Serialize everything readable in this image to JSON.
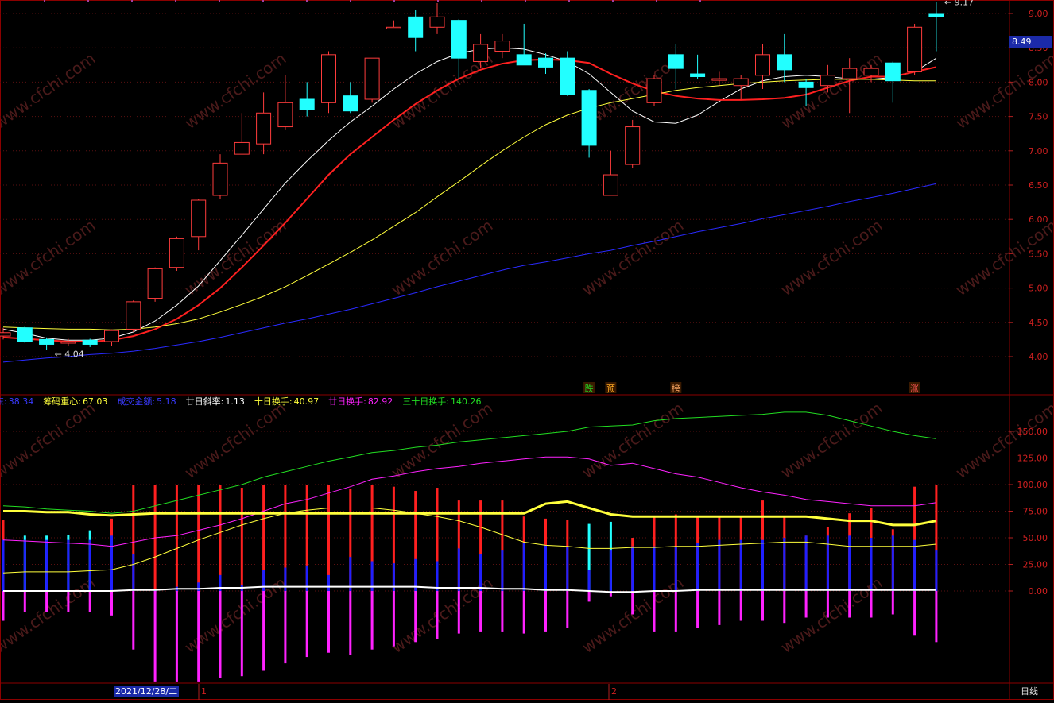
{
  "chart_data": [
    {
      "type": "candlestick",
      "title": "",
      "y_ticks": [
        "9.00",
        "8.50",
        "8.00",
        "7.50",
        "7.00",
        "6.50",
        "6.00",
        "5.50",
        "5.00",
        "4.50",
        "4.00"
      ],
      "ylim": [
        3.55,
        9.2
      ],
      "grid": true,
      "candles": [
        {
          "o": 4.3,
          "h": 4.42,
          "l": 4.25,
          "c": 4.35
        },
        {
          "o": 4.42,
          "h": 4.45,
          "l": 4.2,
          "c": 4.22
        },
        {
          "o": 4.25,
          "h": 4.28,
          "l": 4.1,
          "c": 4.18
        },
        {
          "o": 4.2,
          "h": 4.26,
          "l": 4.15,
          "c": 4.22
        },
        {
          "o": 4.24,
          "h": 4.26,
          "l": 4.14,
          "c": 4.18
        },
        {
          "o": 4.22,
          "h": 4.4,
          "l": 4.15,
          "c": 4.38
        },
        {
          "o": 4.4,
          "h": 4.82,
          "l": 4.36,
          "c": 4.8
        },
        {
          "o": 4.85,
          "h": 5.3,
          "l": 4.8,
          "c": 5.28
        },
        {
          "o": 5.3,
          "h": 5.75,
          "l": 5.25,
          "c": 5.72
        },
        {
          "o": 5.75,
          "h": 6.3,
          "l": 5.55,
          "c": 6.28
        },
        {
          "o": 6.35,
          "h": 6.95,
          "l": 6.3,
          "c": 6.82
        },
        {
          "o": 6.95,
          "h": 7.55,
          "l": 6.95,
          "c": 7.12
        },
        {
          "o": 7.1,
          "h": 7.85,
          "l": 6.95,
          "c": 7.55
        },
        {
          "o": 7.35,
          "h": 8.1,
          "l": 7.3,
          "c": 7.7
        },
        {
          "o": 7.75,
          "h": 8.0,
          "l": 7.5,
          "c": 7.6
        },
        {
          "o": 7.7,
          "h": 8.45,
          "l": 7.55,
          "c": 8.4
        },
        {
          "o": 7.8,
          "h": 8.0,
          "l": 7.55,
          "c": 7.58
        },
        {
          "o": 7.75,
          "h": 8.35,
          "l": 7.7,
          "c": 8.35
        },
        {
          "o": 8.8,
          "h": 8.9,
          "l": 8.78,
          "c": 8.8
        },
        {
          "o": 8.95,
          "h": 9.05,
          "l": 8.45,
          "c": 8.65
        },
        {
          "o": 8.8,
          "h": 9.15,
          "l": 8.7,
          "c": 8.95
        },
        {
          "o": 8.9,
          "h": 8.92,
          "l": 8.05,
          "c": 8.35
        },
        {
          "o": 8.3,
          "h": 8.7,
          "l": 8.2,
          "c": 8.55
        },
        {
          "o": 8.45,
          "h": 8.7,
          "l": 8.35,
          "c": 8.6
        },
        {
          "o": 8.4,
          "h": 8.85,
          "l": 8.35,
          "c": 8.25
        },
        {
          "o": 8.35,
          "h": 8.42,
          "l": 8.12,
          "c": 8.22
        },
        {
          "o": 8.35,
          "h": 8.45,
          "l": 7.8,
          "c": 7.82
        },
        {
          "o": 7.88,
          "h": 7.9,
          "l": 6.9,
          "c": 7.08
        },
        {
          "o": 6.35,
          "h": 7.0,
          "l": 6.35,
          "c": 6.65
        },
        {
          "o": 6.8,
          "h": 7.45,
          "l": 6.75,
          "c": 7.35
        },
        {
          "o": 7.7,
          "h": 8.1,
          "l": 7.65,
          "c": 8.05
        },
        {
          "o": 8.4,
          "h": 8.55,
          "l": 7.9,
          "c": 8.2
        },
        {
          "o": 8.12,
          "h": 8.4,
          "l": 8.05,
          "c": 8.08
        },
        {
          "o": 8.05,
          "h": 8.15,
          "l": 7.95,
          "c": 8.05
        },
        {
          "o": 7.95,
          "h": 8.1,
          "l": 7.75,
          "c": 8.05
        },
        {
          "o": 8.1,
          "h": 8.55,
          "l": 7.9,
          "c": 8.4
        },
        {
          "o": 8.4,
          "h": 8.7,
          "l": 8.0,
          "c": 8.18
        },
        {
          "o": 8.0,
          "h": 8.05,
          "l": 7.65,
          "c": 7.92
        },
        {
          "o": 7.95,
          "h": 8.25,
          "l": 7.85,
          "c": 8.1
        },
        {
          "o": 8.05,
          "h": 8.35,
          "l": 7.55,
          "c": 8.2
        },
        {
          "o": 8.1,
          "h": 8.25,
          "l": 8.0,
          "c": 8.2
        },
        {
          "o": 8.28,
          "h": 8.3,
          "l": 7.7,
          "c": 8.02
        },
        {
          "o": 8.15,
          "h": 8.85,
          "l": 8.1,
          "c": 8.8
        },
        {
          "o": 9.0,
          "h": 9.17,
          "l": 8.45,
          "c": 8.95
        }
      ],
      "series": [
        {
          "name": "",
          "color": "#ffffff",
          "values": [
            4.4,
            4.34,
            4.27,
            4.24,
            4.24,
            4.27,
            4.36,
            4.52,
            4.75,
            5.03,
            5.4,
            5.77,
            6.15,
            6.53,
            6.85,
            7.15,
            7.42,
            7.65,
            7.9,
            8.12,
            8.3,
            8.42,
            8.48,
            8.5,
            8.48,
            8.4,
            8.3,
            8.12,
            7.85,
            7.58,
            7.42,
            7.4,
            7.52,
            7.72,
            7.9,
            8.02,
            8.08,
            8.1,
            8.08,
            8.05,
            8.04,
            8.07,
            8.15,
            8.35
          ]
        },
        {
          "name": "",
          "color": "#ff2020",
          "values": [
            4.28,
            4.26,
            4.24,
            4.22,
            4.22,
            4.24,
            4.3,
            4.4,
            4.55,
            4.75,
            5.0,
            5.3,
            5.62,
            5.95,
            6.3,
            6.65,
            6.95,
            7.2,
            7.45,
            7.68,
            7.88,
            8.05,
            8.18,
            8.27,
            8.32,
            8.33,
            8.32,
            8.28,
            8.12,
            7.98,
            7.87,
            7.8,
            7.76,
            7.74,
            7.74,
            7.75,
            7.77,
            7.82,
            7.92,
            8.02,
            8.08,
            8.08,
            8.15,
            8.22
          ]
        },
        {
          "name": "",
          "color": "#ffff3c",
          "values": [
            4.43,
            4.42,
            4.41,
            4.4,
            4.4,
            4.39,
            4.4,
            4.43,
            4.48,
            4.55,
            4.65,
            4.76,
            4.88,
            5.02,
            5.18,
            5.35,
            5.52,
            5.7,
            5.9,
            6.1,
            6.33,
            6.55,
            6.78,
            7.0,
            7.2,
            7.38,
            7.52,
            7.62,
            7.7,
            7.76,
            7.82,
            7.88,
            7.92,
            7.95,
            7.98,
            8.0,
            8.02,
            8.03,
            8.04,
            8.04,
            8.04,
            8.03,
            8.02,
            8.02
          ]
        },
        {
          "name": "",
          "color": "#2a2aff",
          "values": [
            3.92,
            3.95,
            3.98,
            4.0,
            4.03,
            4.05,
            4.08,
            4.12,
            4.17,
            4.22,
            4.28,
            4.35,
            4.42,
            4.49,
            4.55,
            4.62,
            4.69,
            4.77,
            4.85,
            4.93,
            5.02,
            5.1,
            5.18,
            5.26,
            5.33,
            5.38,
            5.44,
            5.5,
            5.55,
            5.62,
            5.68,
            5.75,
            5.82,
            5.88,
            5.94,
            6.01,
            6.07,
            6.13,
            6.19,
            6.26,
            6.32,
            6.38,
            6.45,
            6.52
          ]
        }
      ],
      "annotations": [
        {
          "text": "4.04",
          "index": 2,
          "value": 4.04
        },
        {
          "text": "9.17",
          "index": 43,
          "value": 9.17
        }
      ],
      "markers": [
        {
          "text": "跌",
          "index": 27,
          "color": "#22dd22"
        },
        {
          "text": "预",
          "index": 28,
          "color": "#ffaa22"
        },
        {
          "text": "榜",
          "index": 31,
          "color": "#ffaa66"
        },
        {
          "text": "涨",
          "index": 42,
          "color": "#ff5555"
        }
      ],
      "current_price": "8.49"
    },
    {
      "type": "bar",
      "title": "",
      "y_ticks": [
        "150.00",
        "125.00",
        "100.00",
        "75.00",
        "50.00",
        "25.00",
        "0.00"
      ],
      "ylim": [
        -42,
        170
      ],
      "indicators": [
        {
          "label": "东:",
          "value": "38.34",
          "color": "#2a2aff"
        },
        {
          "label": "筹码重心:",
          "value": "67.03",
          "color": "#ffff3c"
        },
        {
          "label": "成交金额:",
          "value": "5.18",
          "color": "#2a2aff"
        },
        {
          "label": "廿日斜率:",
          "value": "1.13",
          "color": "#ffffff"
        },
        {
          "label": "十日换手:",
          "value": "40.97",
          "color": "#ffff3c"
        },
        {
          "label": "廿日换手:",
          "value": "82.92",
          "color": "#ff22ff"
        },
        {
          "label": "三十日换手:",
          "value": "140.26",
          "color": "#22dd22"
        }
      ],
      "bars": [
        {
          "top": 67,
          "blue": 48,
          "top_color": "#ff2020",
          "neg": -28
        },
        {
          "top": 52,
          "blue": 48,
          "top_color": "#22ffff",
          "neg": -20
        },
        {
          "top": 52,
          "blue": 48,
          "top_color": "#22ffff",
          "neg": -20
        },
        {
          "top": 53,
          "blue": 48,
          "top_color": "#22ffff",
          "neg": -20
        },
        {
          "top": 57,
          "blue": 48,
          "top_color": "#22ffff",
          "neg": -20
        },
        {
          "top": 68,
          "blue": 52,
          "top_color": "#ff2020",
          "neg": -23
        },
        {
          "top": 100,
          "blue": 35,
          "top_color": "#ff2020",
          "neg": -55
        },
        {
          "top": 100,
          "blue": 2,
          "top_color": "#ff2020",
          "neg": -85
        },
        {
          "top": 100,
          "blue": 4,
          "top_color": "#ff2020",
          "neg": -85
        },
        {
          "top": 100,
          "blue": 8,
          "top_color": "#ff2020",
          "neg": -85
        },
        {
          "top": 100,
          "blue": 15,
          "top_color": "#ff2020",
          "neg": -82
        },
        {
          "top": 97,
          "blue": 6,
          "top_color": "#ff2020",
          "neg": -80
        },
        {
          "top": 100,
          "blue": 20,
          "top_color": "#ff2020",
          "neg": -75
        },
        {
          "top": 100,
          "blue": 22,
          "top_color": "#ff2020",
          "neg": -68
        },
        {
          "top": 100,
          "blue": 24,
          "top_color": "#ff2020",
          "neg": -62
        },
        {
          "top": 100,
          "blue": 15,
          "top_color": "#ff2020",
          "neg": -58
        },
        {
          "top": 96,
          "blue": 32,
          "top_color": "#ff2020",
          "neg": -60
        },
        {
          "top": 100,
          "blue": 28,
          "top_color": "#ff2020",
          "neg": -55
        },
        {
          "top": 98,
          "blue": 26,
          "top_color": "#ff2020",
          "neg": -52
        },
        {
          "top": 94,
          "blue": 30,
          "top_color": "#ff2020",
          "neg": -48
        },
        {
          "top": 97,
          "blue": 28,
          "top_color": "#ff2020",
          "neg": -45
        },
        {
          "top": 85,
          "blue": 40,
          "top_color": "#ff2020",
          "neg": -40
        },
        {
          "top": 85,
          "blue": 35,
          "top_color": "#ff2020",
          "neg": -38
        },
        {
          "top": 85,
          "blue": 38,
          "top_color": "#ff2020",
          "neg": -38
        },
        {
          "top": 70,
          "blue": 45,
          "top_color": "#ff2020",
          "neg": -40
        },
        {
          "top": 68,
          "blue": 43,
          "top_color": "#ff2020",
          "neg": -38
        },
        {
          "top": 67,
          "blue": 42,
          "top_color": "#ff2020",
          "neg": -35
        },
        {
          "top": 63,
          "blue": 20,
          "top_color": "#22ffff",
          "neg": -10
        },
        {
          "top": 65,
          "blue": 38,
          "top_color": "#22ffff",
          "neg": -5
        },
        {
          "top": 50,
          "blue": 42,
          "top_color": "#ff2020",
          "neg": -22
        },
        {
          "top": 70,
          "blue": 42,
          "top_color": "#ff2020",
          "neg": -38
        },
        {
          "top": 72,
          "blue": 42,
          "top_color": "#ff2020",
          "neg": -38
        },
        {
          "top": 70,
          "blue": 45,
          "top_color": "#ff2020",
          "neg": -35
        },
        {
          "top": 70,
          "blue": 48,
          "top_color": "#ff2020",
          "neg": -32
        },
        {
          "top": 70,
          "blue": 48,
          "top_color": "#ff2020",
          "neg": -28
        },
        {
          "top": 85,
          "blue": 48,
          "top_color": "#ff2020",
          "neg": -28
        },
        {
          "top": 70,
          "blue": 50,
          "top_color": "#ff2020",
          "neg": -30
        },
        {
          "top": 52,
          "blue": 52,
          "top_color": "#ff2020",
          "neg": -25
        },
        {
          "top": 60,
          "blue": 52,
          "top_color": "#ff2020",
          "neg": -25
        },
        {
          "top": 73,
          "blue": 52,
          "top_color": "#ff2020",
          "neg": -25
        },
        {
          "top": 78,
          "blue": 50,
          "top_color": "#ff2020",
          "neg": -25
        },
        {
          "top": 58,
          "blue": 52,
          "top_color": "#ff2020",
          "neg": -22
        },
        {
          "top": 98,
          "blue": 48,
          "top_color": "#ff2020",
          "neg": -42
        },
        {
          "top": 100,
          "blue": 38,
          "top_color": "#ff2020",
          "neg": -48
        }
      ],
      "series": [
        {
          "name": "十日换手",
          "color": "#ffff3c",
          "values": [
            17,
            18,
            18,
            18,
            19,
            20,
            25,
            32,
            40,
            48,
            55,
            62,
            68,
            73,
            76,
            78,
            78,
            78,
            76,
            73,
            70,
            66,
            60,
            53,
            46,
            43,
            42,
            40,
            40,
            41,
            41,
            42,
            42,
            43,
            44,
            45,
            46,
            46,
            44,
            42,
            42,
            42,
            42,
            44
          ]
        },
        {
          "name": "廿日换手",
          "color": "#ff22ff",
          "values": [
            48,
            47,
            46,
            45,
            44,
            42,
            46,
            50,
            52,
            57,
            62,
            68,
            75,
            82,
            86,
            92,
            98,
            105,
            108,
            112,
            115,
            117,
            120,
            122,
            124,
            126,
            126,
            124,
            118,
            120,
            115,
            110,
            107,
            102,
            97,
            93,
            90,
            86,
            84,
            82,
            80,
            80,
            80,
            83
          ]
        },
        {
          "name": "三十日换手",
          "color": "#22dd22",
          "values": [
            80,
            79,
            77,
            76,
            75,
            73,
            75,
            80,
            85,
            90,
            95,
            100,
            107,
            112,
            117,
            122,
            126,
            130,
            132,
            135,
            137,
            140,
            142,
            144,
            146,
            148,
            150,
            154,
            155,
            156,
            160,
            162,
            163,
            164,
            165,
            166,
            168,
            168,
            165,
            160,
            155,
            150,
            146,
            143
          ]
        },
        {
          "name": "筹码重心",
          "color": "#ffff3c",
          "values": [
            75,
            75,
            74,
            74,
            72,
            71,
            72,
            73,
            73,
            73,
            73,
            73,
            73,
            73,
            73,
            73,
            73,
            73,
            73,
            73,
            73,
            73,
            73,
            73,
            73,
            82,
            84,
            78,
            72,
            70,
            70,
            70,
            70,
            70,
            70,
            70,
            70,
            70,
            68,
            66,
            66,
            62,
            62,
            66
          ]
        },
        {
          "name": "廿日斜率",
          "color": "#ffffff",
          "values": [
            0,
            0,
            0,
            0,
            0,
            0,
            1,
            1,
            2,
            2,
            3,
            3,
            4,
            4,
            4,
            4,
            4,
            4,
            4,
            4,
            3,
            3,
            3,
            2,
            2,
            1,
            1,
            0,
            -1,
            -1,
            0,
            0,
            1,
            1,
            1,
            1,
            1,
            1,
            1,
            1,
            1,
            1,
            1,
            1
          ]
        }
      ]
    }
  ],
  "date_label": "2021/12/28/二",
  "month_labels": [
    "1",
    "2"
  ],
  "period_label": "日线",
  "watermark": "www.cfchi.com"
}
